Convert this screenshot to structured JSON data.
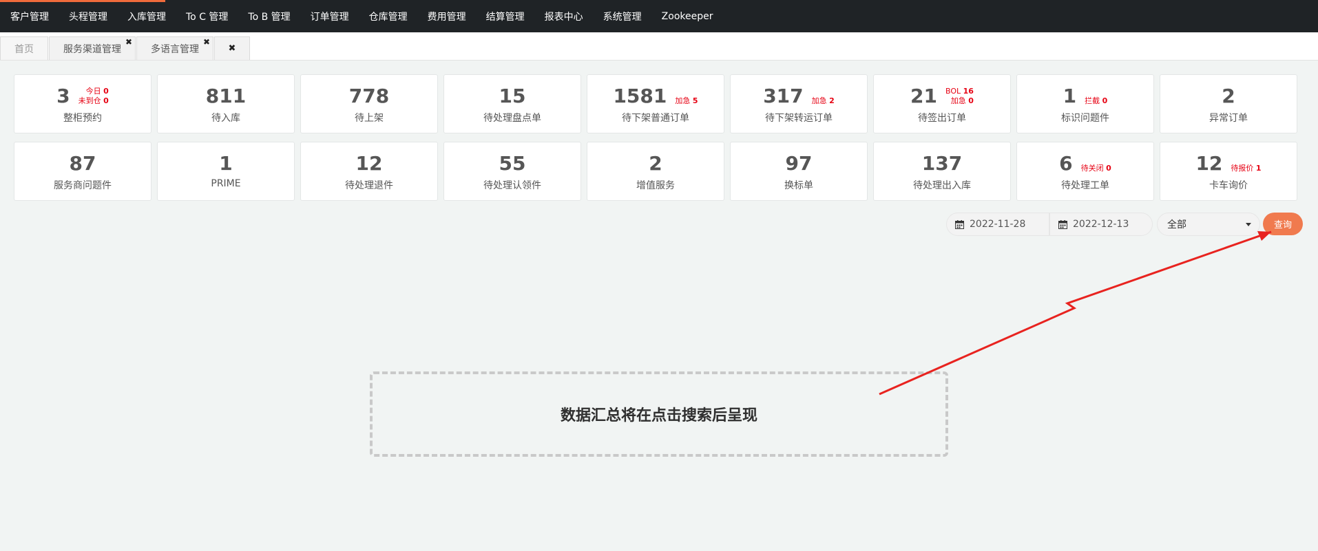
{
  "topnav": {
    "items": [
      {
        "label": "客户管理"
      },
      {
        "label": "头程管理"
      },
      {
        "label": "入库管理"
      },
      {
        "label": "To C 管理"
      },
      {
        "label": "To B 管理"
      },
      {
        "label": "订单管理"
      },
      {
        "label": "仓库管理"
      },
      {
        "label": "费用管理"
      },
      {
        "label": "结算管理"
      },
      {
        "label": "报表中心"
      },
      {
        "label": "系统管理"
      },
      {
        "label": "Zookeeper"
      }
    ],
    "accent_color": "#ef6b3b"
  },
  "tabs": {
    "items": [
      {
        "label": "首页",
        "closable": false
      },
      {
        "label": "服务渠道管理",
        "closable": true,
        "close_glyph": "✖"
      },
      {
        "label": "多语言管理",
        "closable": true,
        "close_glyph": "✖"
      }
    ],
    "close_all_glyph": "✖"
  },
  "stats_row1": [
    {
      "value": "3",
      "label": "整柜预约",
      "sub": [
        {
          "text": "今日",
          "num": "0"
        },
        {
          "text": "未到仓",
          "num": "0"
        }
      ]
    },
    {
      "value": "811",
      "label": "待入库",
      "sub": []
    },
    {
      "value": "778",
      "label": "待上架",
      "sub": []
    },
    {
      "value": "15",
      "label": "待处理盘点单",
      "sub": []
    },
    {
      "value": "1581",
      "label": "待下架普通订单",
      "sub": [
        {
          "text": "加急",
          "num": "5"
        }
      ]
    },
    {
      "value": "317",
      "label": "待下架转运订单",
      "sub": [
        {
          "text": "加急",
          "num": "2"
        }
      ]
    },
    {
      "value": "21",
      "label": "待签出订单",
      "sub": [
        {
          "text": "BOL",
          "num": "16"
        },
        {
          "text": "加急",
          "num": "0"
        }
      ]
    },
    {
      "value": "1",
      "label": "标识问题件",
      "sub": [
        {
          "text": "拦截",
          "num": "0"
        }
      ]
    },
    {
      "value": "2",
      "label": "异常订单",
      "sub": []
    }
  ],
  "stats_row2": [
    {
      "value": "87",
      "label": "服务商问题件",
      "sub": []
    },
    {
      "value": "1",
      "label": "PRIME",
      "sub": []
    },
    {
      "value": "12",
      "label": "待处理退件",
      "sub": []
    },
    {
      "value": "55",
      "label": "待处理认领件",
      "sub": []
    },
    {
      "value": "2",
      "label": "增值服务",
      "sub": []
    },
    {
      "value": "97",
      "label": "换标单",
      "sub": []
    },
    {
      "value": "137",
      "label": "待处理出入库",
      "sub": []
    },
    {
      "value": "6",
      "label": "待处理工单",
      "sub": [
        {
          "text": "待关闭",
          "num": "0"
        }
      ]
    },
    {
      "value": "12",
      "label": "卡车询价",
      "sub": [
        {
          "text": "待报价",
          "num": "1"
        }
      ]
    }
  ],
  "filters": {
    "start_date": "2022-11-28",
    "end_date": "2022-12-13",
    "type_select": "全部",
    "query_label": "查询",
    "query_color": "#f07a4e"
  },
  "placeholder": {
    "text": "数据汇总将在点击搜索后呈现"
  },
  "icons": {
    "date": "calendar-icon",
    "close": "close-icon",
    "select": "caret-down-icon"
  },
  "annotation": {
    "arrow_color": "#e8231f"
  }
}
